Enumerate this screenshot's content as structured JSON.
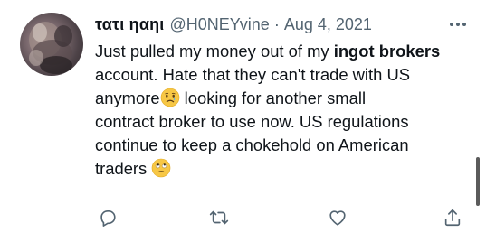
{
  "tweet": {
    "display_name": "τατι ηαηι",
    "handle": "@H0NEYvine",
    "separator": "·",
    "date": "Aug 4, 2021",
    "text": {
      "line1_pre": "Just pulled my money out of my ",
      "line1_bold": "ingot brokers",
      "line2": "account. Hate that they can't trade with US",
      "line3_pre": "anymore",
      "line3_post": " looking for another small",
      "line4": "contract broker to use now. US regulations",
      "line5": "continue to keep a chokehold on American",
      "line6_pre": "traders "
    },
    "emojis": [
      "crying-face-emoji",
      "face-with-rolling-eyes-emoji"
    ]
  },
  "actions": [
    "reply-icon",
    "retweet-icon",
    "like-icon",
    "share-icon"
  ],
  "colors": {
    "text": "#0f1419",
    "meta": "#536471",
    "icon": "#536471"
  }
}
